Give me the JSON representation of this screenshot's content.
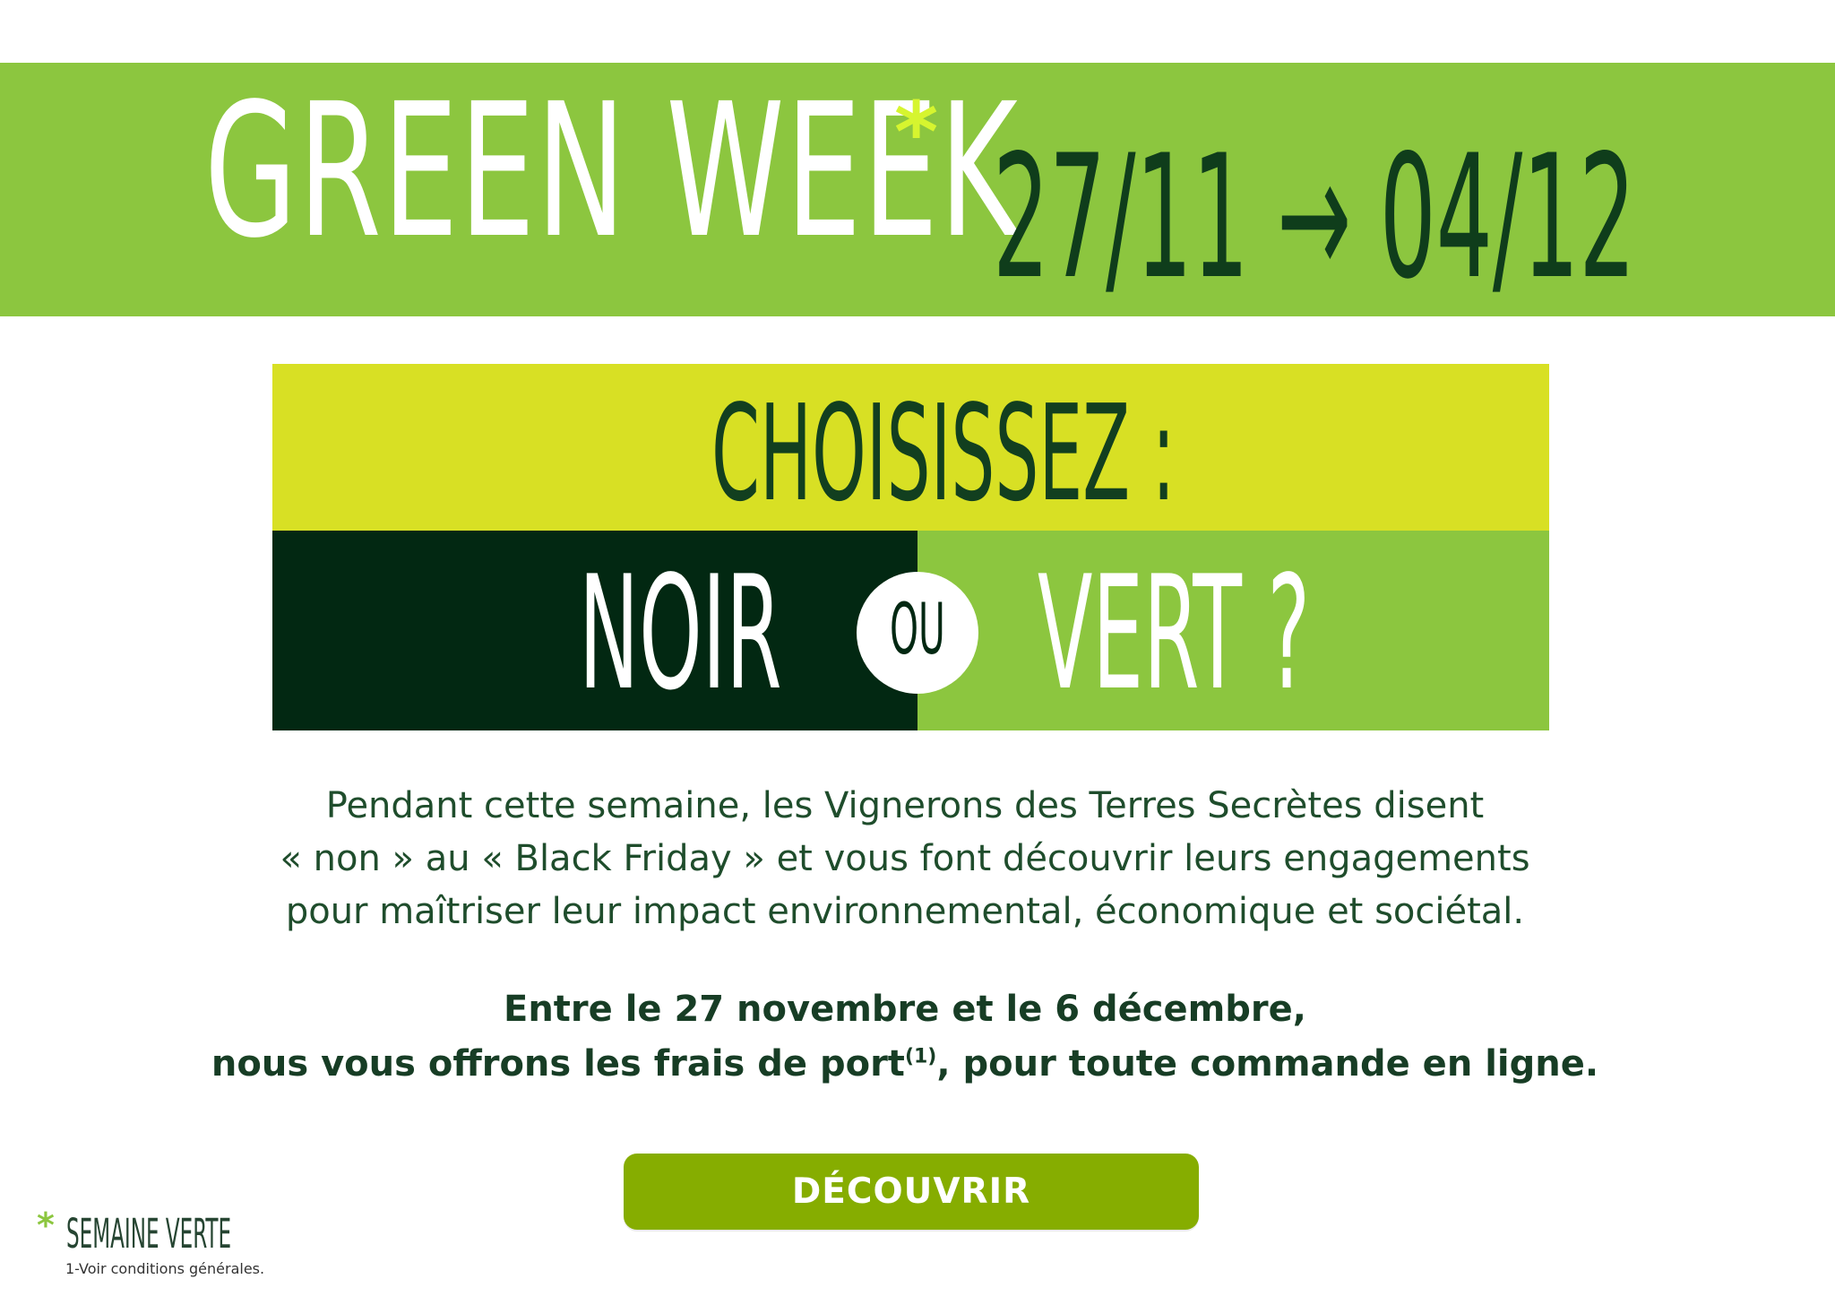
{
  "banner": {
    "title": "GREEN WEEK",
    "asterisk": "*",
    "dates": "27/11 → 04/12"
  },
  "choice": {
    "title": "CHOISISSEZ :",
    "left": "NOIR",
    "middle": "OU",
    "right": "VERT ?"
  },
  "intro": {
    "lines": [
      "Pendant cette semaine, les Vignerons des Terres Secrètes disent",
      "« non » au « Black Friday » et vous font découvrir leurs engagements",
      "pour maîtriser leur impact environnemental, économique et sociétal."
    ]
  },
  "offer": {
    "line1": "Entre le 27 novembre et le 6 décembre,",
    "line2_before": "nous vous offrons les frais de port",
    "line2_sup": "(1)",
    "line2_after": ", pour toute commande en ligne."
  },
  "cta": {
    "label": "DÉCOUVRIR"
  },
  "footnote": {
    "asterisk": "*",
    "title": "SEMAINE VERTE",
    "terms": "1-Voir conditions générales."
  },
  "colors": {
    "banner_green": "#8cc63f",
    "yellow_green": "#d8e024",
    "dark_green": "#022812",
    "button_green": "#86ad00",
    "text_green": "#1f4d2c"
  }
}
